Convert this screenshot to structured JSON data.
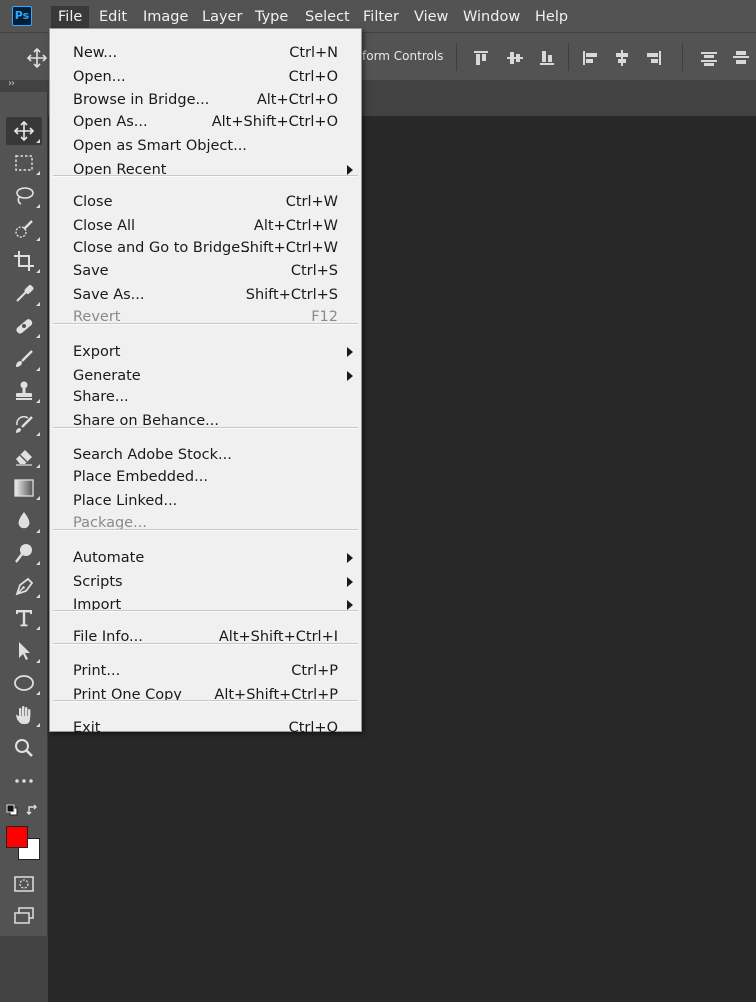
{
  "app": {
    "logo_text": "Ps"
  },
  "menubar": {
    "items": [
      {
        "label": "File",
        "active": true
      },
      {
        "label": "Edit"
      },
      {
        "label": "Image"
      },
      {
        "label": "Layer"
      },
      {
        "label": "Type"
      },
      {
        "label": "Select"
      },
      {
        "label": "Filter"
      },
      {
        "label": "View"
      },
      {
        "label": "Window"
      },
      {
        "label": "Help"
      }
    ]
  },
  "options_bar": {
    "transform_controls_label": "form Controls"
  },
  "tools": [
    {
      "name": "move-tool",
      "selected": true
    },
    {
      "name": "rectangular-marquee-tool"
    },
    {
      "name": "lasso-tool"
    },
    {
      "name": "quick-selection-tool"
    },
    {
      "name": "crop-tool"
    },
    {
      "name": "eyedropper-tool"
    },
    {
      "name": "spot-healing-brush-tool"
    },
    {
      "name": "brush-tool"
    },
    {
      "name": "clone-stamp-tool"
    },
    {
      "name": "history-brush-tool"
    },
    {
      "name": "eraser-tool"
    },
    {
      "name": "gradient-tool"
    },
    {
      "name": "blur-tool"
    },
    {
      "name": "dodge-tool"
    },
    {
      "name": "pen-tool"
    },
    {
      "name": "type-tool"
    },
    {
      "name": "path-selection-tool"
    },
    {
      "name": "ellipse-tool"
    },
    {
      "name": "hand-tool"
    },
    {
      "name": "zoom-tool"
    },
    {
      "name": "edit-toolbar"
    }
  ],
  "colors": {
    "foreground": "#ff0000",
    "background": "#ffffff"
  },
  "file_menu": {
    "groups": [
      [
        {
          "label": "New...",
          "shortcut": "Ctrl+N"
        },
        {
          "label": "Open...",
          "shortcut": "Ctrl+O"
        },
        {
          "label": "Browse in Bridge...",
          "shortcut": "Alt+Ctrl+O"
        },
        {
          "label": "Open As...",
          "shortcut": "Alt+Shift+Ctrl+O"
        },
        {
          "label": "Open as Smart Object...",
          "shortcut": ""
        },
        {
          "label": "Open Recent",
          "shortcut": "",
          "submenu": true
        }
      ],
      [
        {
          "label": "Close",
          "shortcut": "Ctrl+W"
        },
        {
          "label": "Close All",
          "shortcut": "Alt+Ctrl+W"
        },
        {
          "label": "Close and Go to Bridge...",
          "shortcut": "Shift+Ctrl+W"
        },
        {
          "label": "Save",
          "shortcut": "Ctrl+S"
        },
        {
          "label": "Save As...",
          "shortcut": "Shift+Ctrl+S"
        },
        {
          "label": "Revert",
          "shortcut": "F12",
          "disabled": true
        }
      ],
      [
        {
          "label": "Export",
          "shortcut": "",
          "submenu": true
        },
        {
          "label": "Generate",
          "shortcut": "",
          "submenu": true
        },
        {
          "label": "Share...",
          "shortcut": ""
        },
        {
          "label": "Share on Behance...",
          "shortcut": ""
        }
      ],
      [
        {
          "label": "Search Adobe Stock...",
          "shortcut": ""
        },
        {
          "label": "Place Embedded...",
          "shortcut": ""
        },
        {
          "label": "Place Linked...",
          "shortcut": ""
        },
        {
          "label": "Package...",
          "shortcut": "",
          "disabled": true
        }
      ],
      [
        {
          "label": "Automate",
          "shortcut": "",
          "submenu": true
        },
        {
          "label": "Scripts",
          "shortcut": "",
          "submenu": true
        },
        {
          "label": "Import",
          "shortcut": "",
          "submenu": true
        }
      ],
      [
        {
          "label": "File Info...",
          "shortcut": "Alt+Shift+Ctrl+I"
        }
      ],
      [
        {
          "label": "Print...",
          "shortcut": "Ctrl+P"
        },
        {
          "label": "Print One Copy",
          "shortcut": "Alt+Shift+Ctrl+P"
        }
      ],
      [
        {
          "label": "Exit",
          "shortcut": "Ctrl+Q"
        }
      ]
    ]
  }
}
